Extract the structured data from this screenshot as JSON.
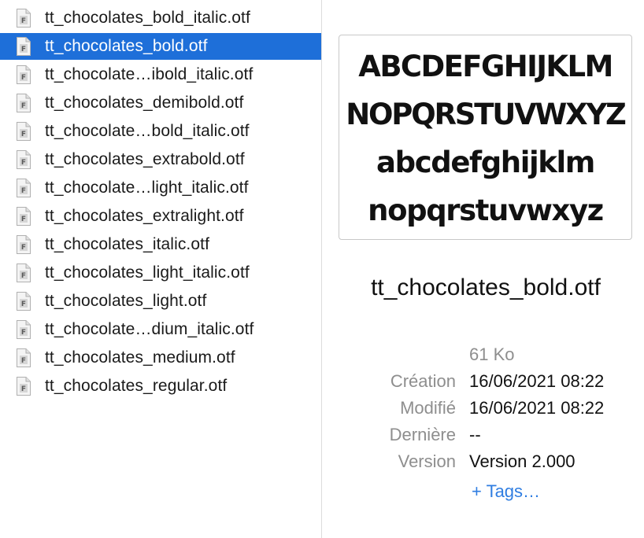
{
  "file_list": {
    "selected_index": 1,
    "items": [
      {
        "name": "tt_chocolates_bold_italic.otf"
      },
      {
        "name": "tt_chocolates_bold.otf"
      },
      {
        "name": "tt_chocolate…ibold_italic.otf"
      },
      {
        "name": "tt_chocolates_demibold.otf"
      },
      {
        "name": "tt_chocolate…bold_italic.otf"
      },
      {
        "name": "tt_chocolates_extrabold.otf"
      },
      {
        "name": "tt_chocolate…light_italic.otf"
      },
      {
        "name": "tt_chocolates_extralight.otf"
      },
      {
        "name": "tt_chocolates_italic.otf"
      },
      {
        "name": "tt_chocolates_light_italic.otf"
      },
      {
        "name": "tt_chocolates_light.otf"
      },
      {
        "name": "tt_chocolate…dium_italic.otf"
      },
      {
        "name": "tt_chocolates_medium.otf"
      },
      {
        "name": "tt_chocolates_regular.otf"
      }
    ],
    "item_icon": "font-file-icon"
  },
  "preview": {
    "specimen": {
      "line1": "ABCDEFGHIJKLM",
      "line2": "NOPQRSTUVWXYZ",
      "line3": "abcdefghijklm",
      "line4": "nopqrstuvwxyz"
    },
    "filename": "tt_chocolates_bold.otf",
    "size": "61 Ko",
    "info": {
      "created_label": "Création",
      "created_value": "16/06/2021 08:22",
      "modified_label": "Modifié",
      "modified_value": "16/06/2021 08:22",
      "last_opened_label": "Dernière",
      "last_opened_value": "--",
      "version_label": "Version",
      "version_value": "Version 2.000"
    },
    "tags_link": "+ Tags…"
  },
  "colors": {
    "selection": "#1e6fd9",
    "link": "#2f7de1",
    "label": "#8e8e8e"
  }
}
